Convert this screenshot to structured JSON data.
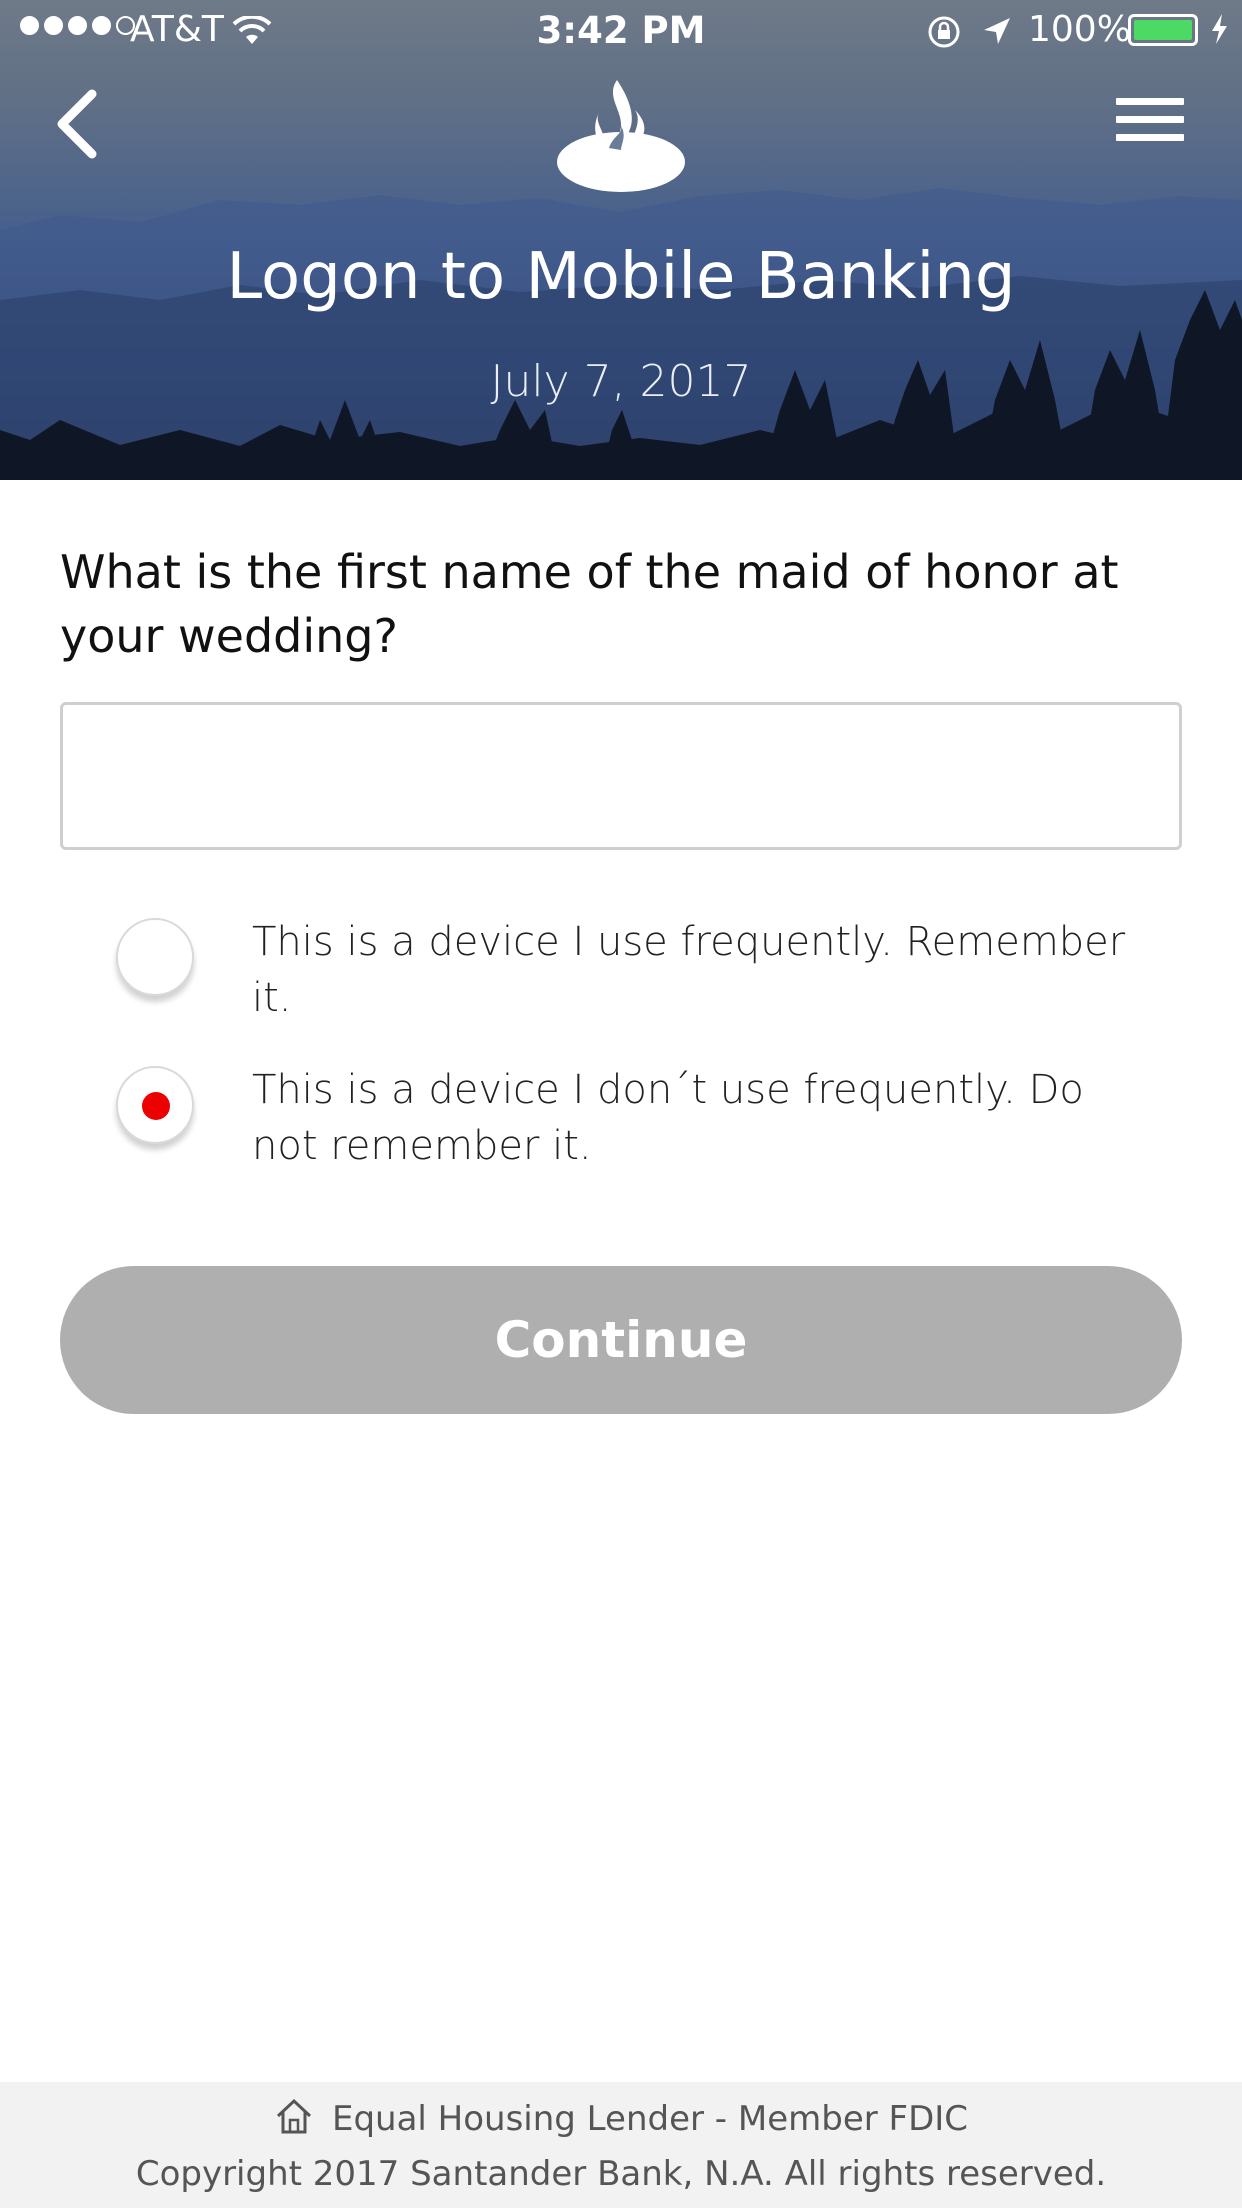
{
  "status_bar": {
    "carrier": "AT&T",
    "time": "3:42 PM",
    "battery_percent": "100%",
    "signal_bars": 4,
    "signal_total": 5,
    "battery_color": "#4cd964"
  },
  "header": {
    "title": "Logon to Mobile Banking",
    "date": "July 7, 2017",
    "back_icon": "chevron-left-icon",
    "menu_icon": "hamburger-menu-icon",
    "logo_icon": "santander-flame-logo"
  },
  "form": {
    "question": "What is the first name of the maid of honor at your wedding?",
    "answer_value": "",
    "answer_placeholder": "",
    "options": [
      {
        "label": "This is a device I use frequently. Remember it.",
        "selected": false
      },
      {
        "label": "This is a device I don´t use frequently. Do not remember it.",
        "selected": true
      }
    ],
    "continue_label": "Continue",
    "continue_enabled": false,
    "accent_color": "#ec0000",
    "button_disabled_color": "#afafaf"
  },
  "footer": {
    "line1": "Equal Housing Lender - Member FDIC",
    "line2": "Copyright 2017 Santander Bank, N.A. All rights reserved.",
    "icon": "house-icon"
  }
}
